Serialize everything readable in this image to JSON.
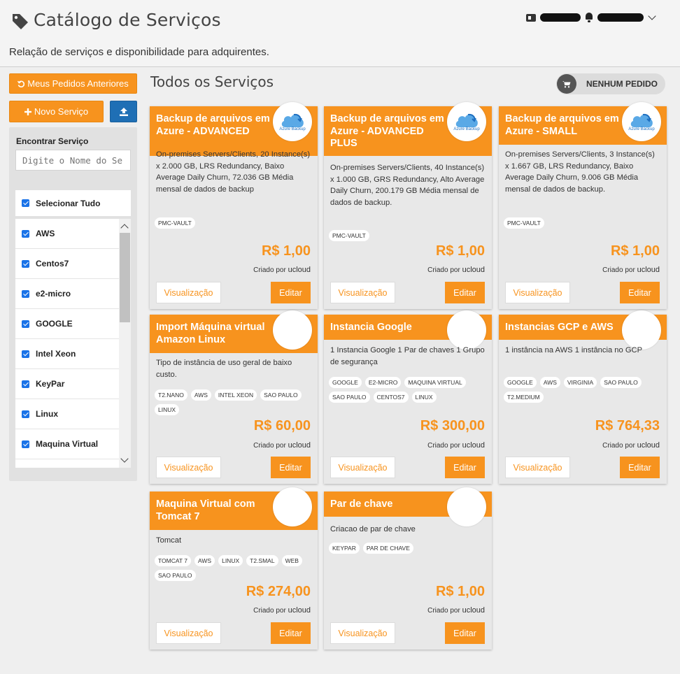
{
  "header": {
    "title": "Catálogo de Serviços",
    "subtitle": "Relação de serviços e disponibilidade para adquirentes."
  },
  "sidebar": {
    "history_button": "Meus Pedidos Anteriores",
    "new_service_button": "Novo Serviço",
    "find_label": "Encontrar Serviço",
    "search_placeholder": "Digite o Nome do Serviço",
    "select_all": "Selecionar Tudo",
    "tags": [
      "AWS",
      "Centos7",
      "e2-micro",
      "GOOGLE",
      "Intel Xeon",
      "KeyPar",
      "Linux",
      "Maquina Virtual"
    ]
  },
  "main": {
    "title": "Todos os Serviços",
    "order_button": "NENHUM PEDIDO"
  },
  "colors": {
    "accent": "#f7931e",
    "upload_button": "#1f6fb5",
    "checkbox": "#1a73e8"
  },
  "cards": [
    {
      "title": "Backup de arquivos em Azure - ADVANCED",
      "logo_caption": "Azure Backup",
      "description": "On-premises Servers/Clients, 20 Instance(s) x 2.000 GB, LRS Redundancy, Baixo Average Daily Churn, 72.036 GB Média mensal de dados de backup",
      "tags": [
        "PMC-VAULT"
      ],
      "price": "R$ 1,00",
      "created_prefix": "Criado por",
      "created_by": "ucloud",
      "view_label": "Visualização",
      "edit_label": "Editar"
    },
    {
      "title": "Backup de arquivos em Azure - ADVANCED PLUS",
      "logo_caption": "Azure Backup",
      "description": "On-premises Servers/Clients, 40 Instance(s) x 1.000 GB, GRS Redundancy, Alto Average Daily Churn, 200.179 GB Média mensal de dados de backup.",
      "tags": [
        "PMC-VAULT"
      ],
      "price": "R$ 1,00",
      "created_prefix": "Criado por",
      "created_by": "ucloud",
      "view_label": "Visualização",
      "edit_label": "Editar"
    },
    {
      "title": "Backup de arquivos em Azure - SMALL",
      "logo_caption": "Azure Backup",
      "description": "On-premises Servers/Clients, 3 Instance(s) x 1.667 GB, LRS Redundancy, Baixo Average Daily Churn, 9.006 GB Média mensal de dados de backup.",
      "tags": [
        "PMC-VAULT"
      ],
      "price": "R$ 1,00",
      "created_prefix": "Criado por",
      "created_by": "ucloud",
      "view_label": "Visualização",
      "edit_label": "Editar"
    },
    {
      "title": "Import Máquina virtual Amazon Linux",
      "logo_caption": "",
      "description": "Tipo de instância de uso geral de baixo custo.",
      "tags": [
        "T2.NANO",
        "AWS",
        "INTEL XEON",
        "SAO PAULO",
        "LINUX"
      ],
      "price": "R$ 60,00",
      "created_prefix": "Criado por",
      "created_by": "ucloud",
      "view_label": "Visualização",
      "edit_label": "Editar"
    },
    {
      "title": "Instancia Google",
      "logo_caption": "",
      "description": "1 Instancia Google 1 Par de chaves 1 Grupo de segurança",
      "tags": [
        "GOOGLE",
        "E2-MICRO",
        "MAQUINA VIRTUAL",
        "SAO PAULO",
        "CENTOS7",
        "LINUX"
      ],
      "price": "R$ 300,00",
      "created_prefix": "Criado por",
      "created_by": "ucloud",
      "view_label": "Visualização",
      "edit_label": "Editar"
    },
    {
      "title": "Instancias GCP e AWS",
      "logo_caption": "",
      "description": "1 instância na AWS 1 instância no GCP",
      "tags": [
        "GOOGLE",
        "AWS",
        "VIRGINIA",
        "SAO PAULO",
        "T2.MEDIUM"
      ],
      "price": "R$ 764,33",
      "created_prefix": "Criado por",
      "created_by": "ucloud",
      "view_label": "Visualização",
      "edit_label": "Editar"
    },
    {
      "title": "Maquina Virtual com Tomcat 7",
      "logo_caption": "",
      "description": "Tomcat",
      "tags": [
        "TOMCAT 7",
        "AWS",
        "LINUX",
        "T2.SMAL",
        "WEB",
        "SAO PAULO"
      ],
      "price": "R$ 274,00",
      "created_prefix": "Criado por",
      "created_by": "ucloud",
      "view_label": "Visualização",
      "edit_label": "Editar"
    },
    {
      "title": "Par de chave",
      "logo_caption": "",
      "description": "Criacao de par de chave",
      "tags": [
        "KEYPAR",
        "PAR DE CHAVE"
      ],
      "price": "R$ 1,00",
      "created_prefix": "Criado por",
      "created_by": "ucloud",
      "view_label": "Visualização",
      "edit_label": "Editar"
    }
  ]
}
